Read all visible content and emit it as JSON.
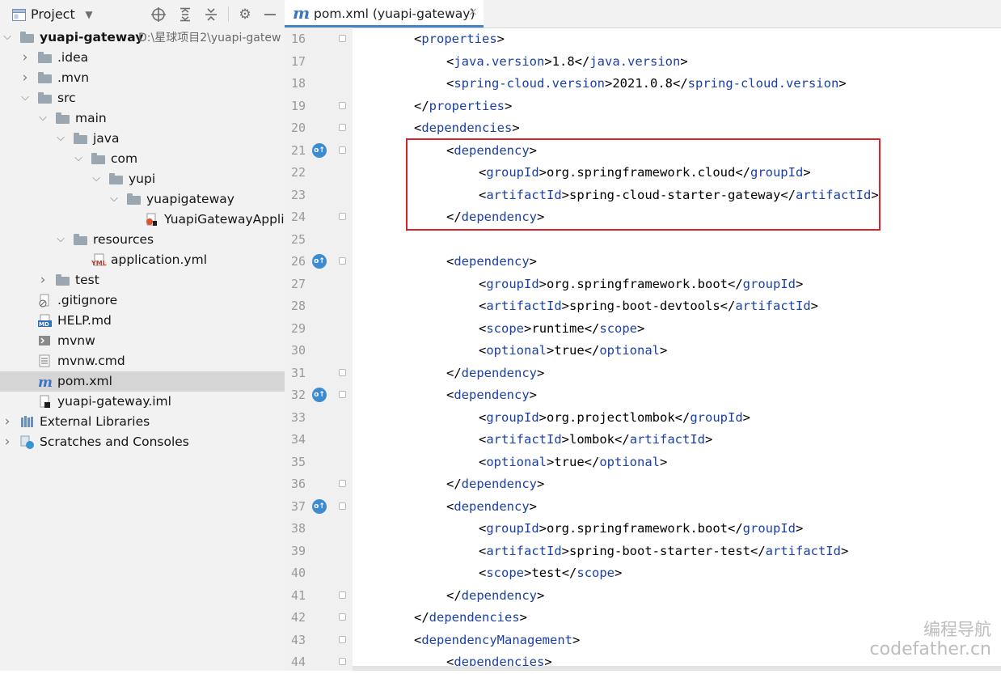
{
  "project_panel": {
    "title": "Project",
    "tree": [
      {
        "label": "yuapi-gateway",
        "path": "D:\\星球项目2\\yuapi-gatew",
        "bold": true,
        "depth": 0,
        "expanded": true,
        "icon": "module-folder-icon"
      },
      {
        "label": ".idea",
        "depth": 1,
        "expanded": false,
        "icon": "folder-icon"
      },
      {
        "label": ".mvn",
        "depth": 1,
        "expanded": false,
        "icon": "folder-icon"
      },
      {
        "label": "src",
        "depth": 1,
        "expanded": true,
        "icon": "folder-icon"
      },
      {
        "label": "main",
        "depth": 2,
        "expanded": true,
        "icon": "folder-icon"
      },
      {
        "label": "java",
        "depth": 3,
        "expanded": true,
        "icon": "source-folder-icon"
      },
      {
        "label": "com",
        "depth": 4,
        "expanded": true,
        "icon": "package-icon"
      },
      {
        "label": "yupi",
        "depth": 5,
        "expanded": true,
        "icon": "package-icon"
      },
      {
        "label": "yuapigateway",
        "depth": 6,
        "expanded": true,
        "icon": "package-icon"
      },
      {
        "label": "YuapiGatewayApplic",
        "depth": 7,
        "icon": "spring-class-icon"
      },
      {
        "label": "resources",
        "depth": 3,
        "expanded": true,
        "icon": "resources-folder-icon"
      },
      {
        "label": "application.yml",
        "depth": 4,
        "icon": "yml-file-icon"
      },
      {
        "label": "test",
        "depth": 2,
        "expanded": false,
        "icon": "folder-icon"
      },
      {
        "label": ".gitignore",
        "depth": 1,
        "icon": "gitignore-file-icon"
      },
      {
        "label": "HELP.md",
        "depth": 1,
        "icon": "markdown-file-icon"
      },
      {
        "label": "mvnw",
        "depth": 1,
        "icon": "shell-file-icon"
      },
      {
        "label": "mvnw.cmd",
        "depth": 1,
        "icon": "text-file-icon"
      },
      {
        "label": "pom.xml",
        "depth": 1,
        "icon": "maven-file-icon",
        "selected": true
      },
      {
        "label": "yuapi-gateway.iml",
        "depth": 1,
        "icon": "iml-file-icon"
      },
      {
        "label": "External Libraries",
        "depth": 0,
        "expanded": false,
        "icon": "libraries-icon"
      },
      {
        "label": "Scratches and Consoles",
        "depth": 0,
        "expanded": false,
        "icon": "scratches-icon"
      }
    ]
  },
  "editor": {
    "tab": {
      "label": "pom.xml (yuapi-gateway)",
      "icon": "maven-file-icon",
      "close": "×"
    },
    "lines": [
      {
        "n": "16",
        "indent": 1,
        "kind": "open",
        "tag": "properties",
        "fold": true
      },
      {
        "n": "17",
        "indent": 2,
        "kind": "elem",
        "tag": "java.version",
        "text": "1.8"
      },
      {
        "n": "18",
        "indent": 2,
        "kind": "elem",
        "tag": "spring-cloud.version",
        "text": "2021.0.8"
      },
      {
        "n": "19",
        "indent": 1,
        "kind": "close",
        "tag": "properties",
        "fold": true
      },
      {
        "n": "20",
        "indent": 1,
        "kind": "open",
        "tag": "dependencies",
        "fold": true
      },
      {
        "n": "21",
        "indent": 2,
        "kind": "open",
        "tag": "dependency",
        "fold": true,
        "mark": true
      },
      {
        "n": "22",
        "indent": 3,
        "kind": "elem",
        "tag": "groupId",
        "text": "org.springframework.cloud"
      },
      {
        "n": "23",
        "indent": 3,
        "kind": "elem",
        "tag": "artifactId",
        "text": "spring-cloud-starter-gateway"
      },
      {
        "n": "24",
        "indent": 2,
        "kind": "close",
        "tag": "dependency",
        "fold": true
      },
      {
        "n": "25",
        "indent": 0,
        "kind": "blank"
      },
      {
        "n": "26",
        "indent": 2,
        "kind": "open",
        "tag": "dependency",
        "fold": true,
        "mark": true
      },
      {
        "n": "27",
        "indent": 3,
        "kind": "elem",
        "tag": "groupId",
        "text": "org.springframework.boot"
      },
      {
        "n": "28",
        "indent": 3,
        "kind": "elem",
        "tag": "artifactId",
        "text": "spring-boot-devtools"
      },
      {
        "n": "29",
        "indent": 3,
        "kind": "elem",
        "tag": "scope",
        "text": "runtime"
      },
      {
        "n": "30",
        "indent": 3,
        "kind": "elem",
        "tag": "optional",
        "text": "true"
      },
      {
        "n": "31",
        "indent": 2,
        "kind": "close",
        "tag": "dependency",
        "fold": true
      },
      {
        "n": "32",
        "indent": 2,
        "kind": "open",
        "tag": "dependency",
        "fold": true,
        "mark": true
      },
      {
        "n": "33",
        "indent": 3,
        "kind": "elem",
        "tag": "groupId",
        "text": "org.projectlombok"
      },
      {
        "n": "34",
        "indent": 3,
        "kind": "elem",
        "tag": "artifactId",
        "text": "lombok"
      },
      {
        "n": "35",
        "indent": 3,
        "kind": "elem",
        "tag": "optional",
        "text": "true"
      },
      {
        "n": "36",
        "indent": 2,
        "kind": "close",
        "tag": "dependency",
        "fold": true
      },
      {
        "n": "37",
        "indent": 2,
        "kind": "open",
        "tag": "dependency",
        "fold": true,
        "mark": true
      },
      {
        "n": "38",
        "indent": 3,
        "kind": "elem",
        "tag": "groupId",
        "text": "org.springframework.boot"
      },
      {
        "n": "39",
        "indent": 3,
        "kind": "elem",
        "tag": "artifactId",
        "text": "spring-boot-starter-test"
      },
      {
        "n": "40",
        "indent": 3,
        "kind": "elem",
        "tag": "scope",
        "text": "test"
      },
      {
        "n": "41",
        "indent": 2,
        "kind": "close",
        "tag": "dependency",
        "fold": true
      },
      {
        "n": "42",
        "indent": 1,
        "kind": "close",
        "tag": "dependencies",
        "fold": true
      },
      {
        "n": "43",
        "indent": 1,
        "kind": "open",
        "tag": "dependencyManagement",
        "fold": true
      },
      {
        "n": "44",
        "indent": 2,
        "kind": "open",
        "tag": "dependencies",
        "fold": true
      }
    ],
    "gutter_mark_glyph": "o↑",
    "highlight_color": "#d8232a"
  },
  "watermark": {
    "line1": "编程导航",
    "line2": "codefather.cn"
  }
}
